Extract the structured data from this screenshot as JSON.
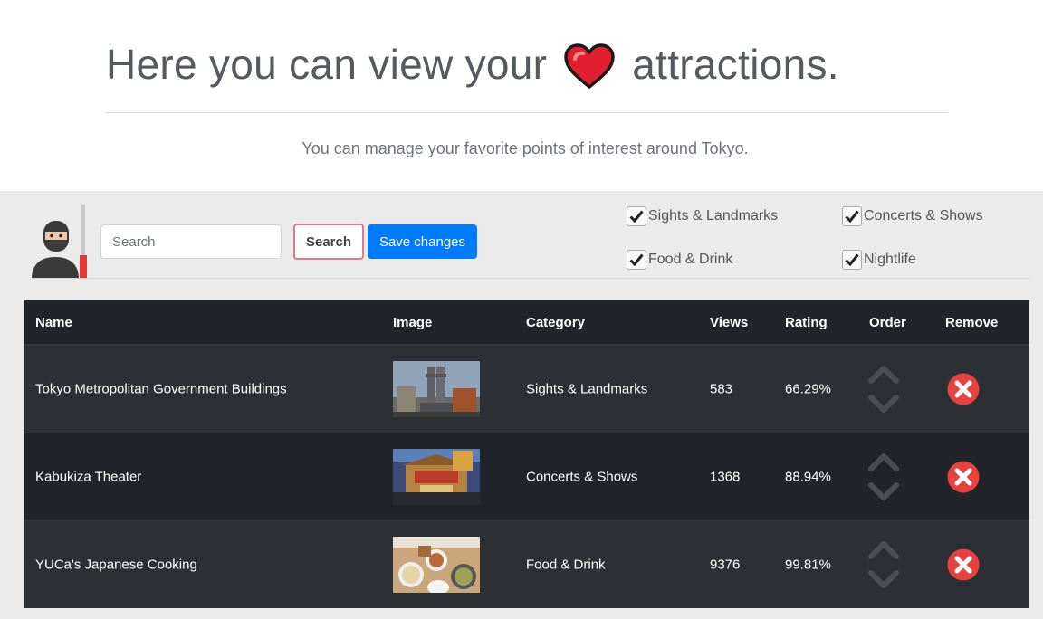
{
  "hero": {
    "title_before": "Here you can view your",
    "title_after": "attractions.",
    "heart_icon": "heart-icon",
    "subtitle": "You can manage your favorite points of interest around Tokyo."
  },
  "toolbar": {
    "search_placeholder": "Search",
    "search_label": "Search",
    "save_label": "Save changes",
    "filters": [
      {
        "label": "Sights & Landmarks",
        "checked": true
      },
      {
        "label": "Concerts & Shows",
        "checked": true
      },
      {
        "label": "Food & Drink",
        "checked": true
      },
      {
        "label": "Nightlife",
        "checked": true
      }
    ]
  },
  "table": {
    "headers": [
      "Name",
      "Image",
      "Category",
      "Views",
      "Rating",
      "Order",
      "Remove"
    ],
    "rows": [
      {
        "name": "Tokyo Metropolitan Government Buildings",
        "image": "skyscraper-photo",
        "category": "Sights & Landmarks",
        "views": "583",
        "rating": "66.29%"
      },
      {
        "name": "Kabukiza Theater",
        "image": "theater-photo",
        "category": "Concerts & Shows",
        "views": "1368",
        "rating": "88.94%"
      },
      {
        "name": "YUCa's Japanese Cooking",
        "image": "food-photo",
        "category": "Food & Drink",
        "views": "9376",
        "rating": "99.81%"
      }
    ]
  },
  "colors": {
    "accent_blue": "#007bff",
    "search_border": "#e07a8a",
    "heart_red": "#e0202e",
    "remove_red": "#e8423f",
    "table_dark": "#212529"
  }
}
